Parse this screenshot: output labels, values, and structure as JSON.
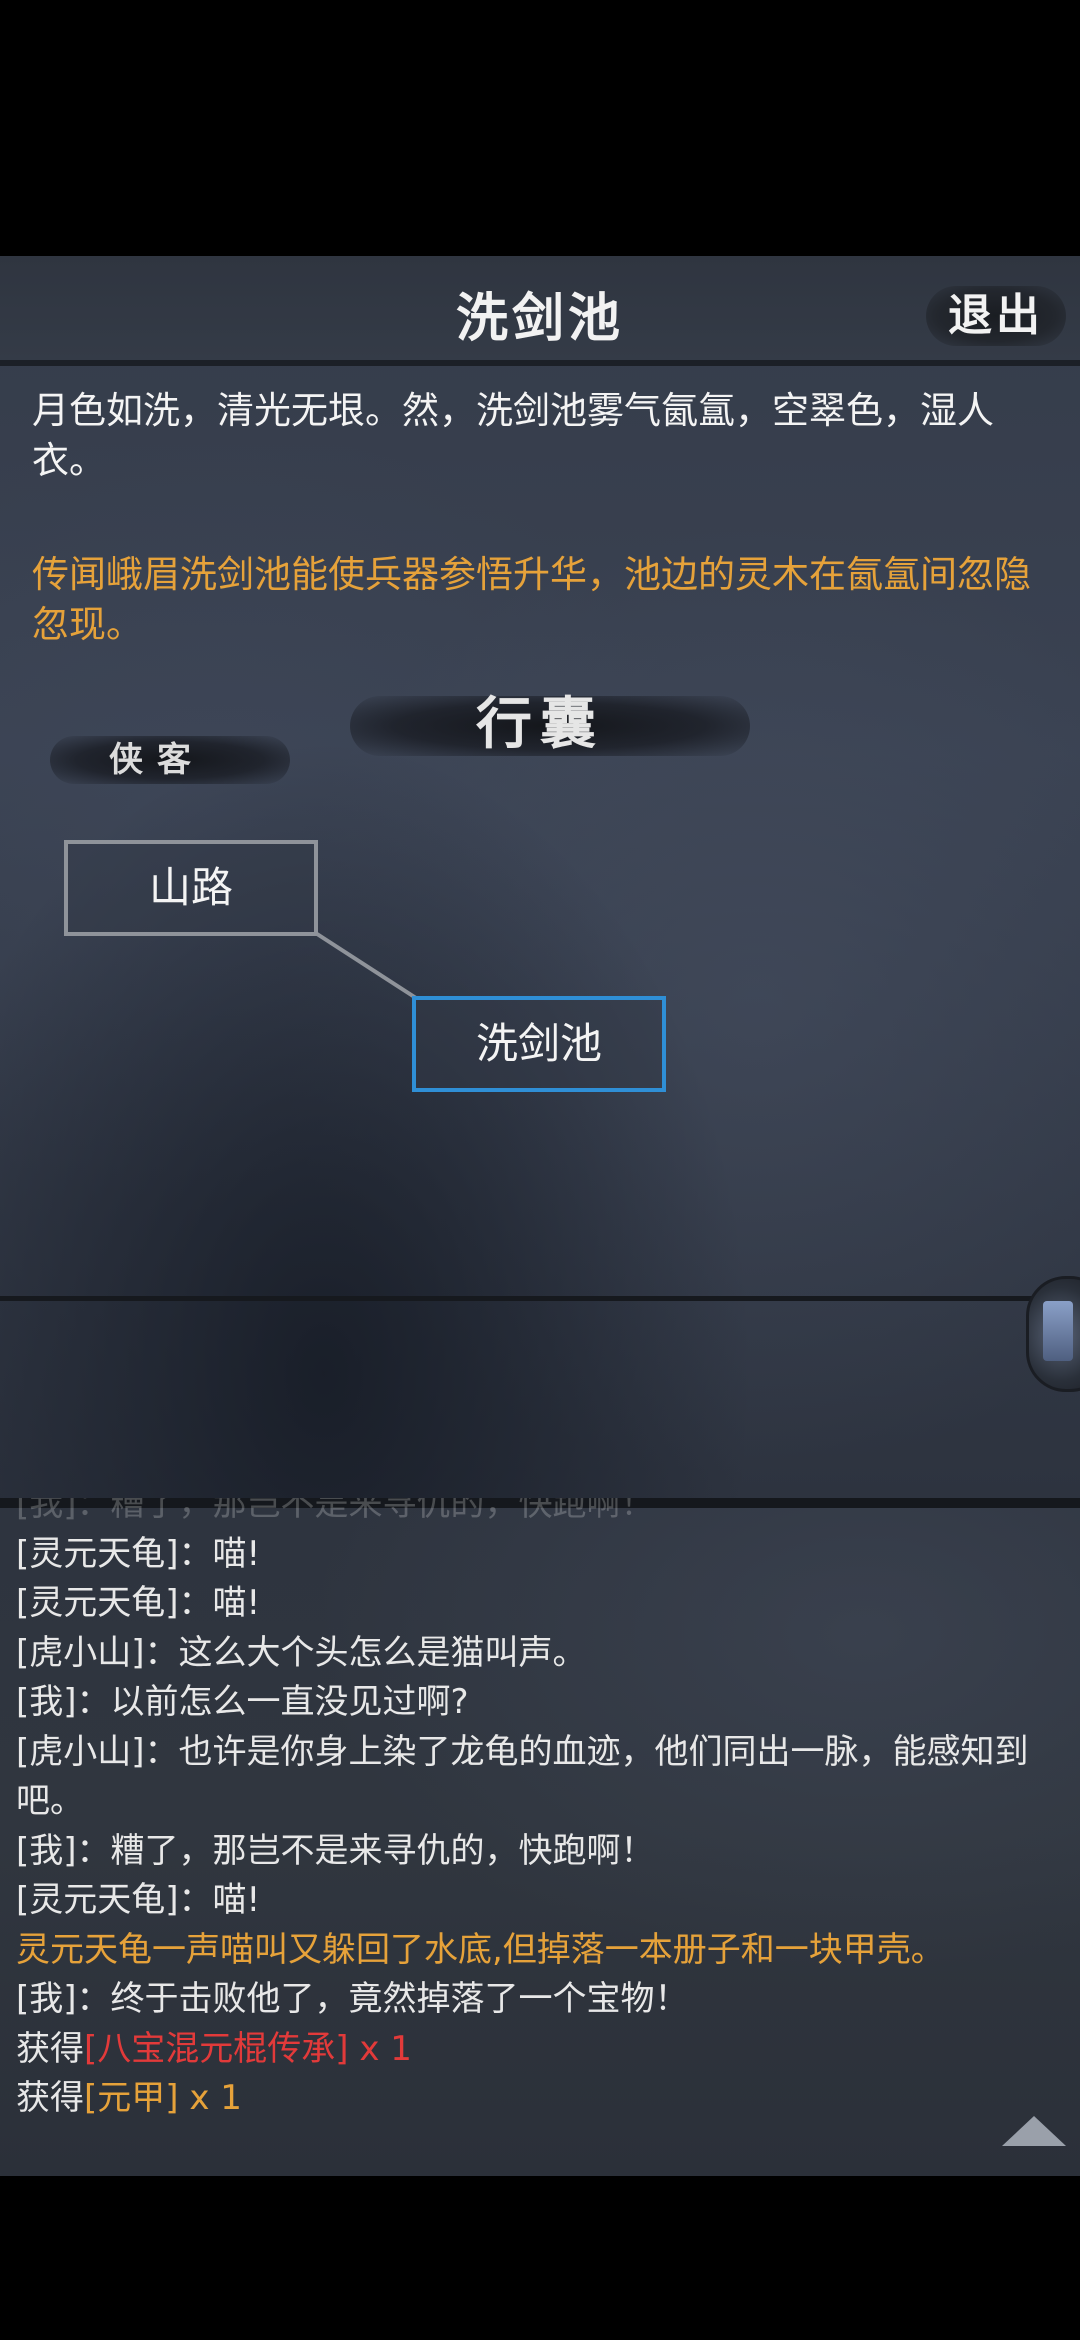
{
  "header": {
    "title": "洗剑池",
    "exit_label": "退出"
  },
  "location": {
    "description": "月色如洗，清光无垠。然，洗剑池雾气氤氲，空翠色，湿人衣。",
    "rumor": "传闻峨眉洗剑池能使兵器参悟升华，池边的灵木在氤氲间忽隐忽现。"
  },
  "menu": {
    "bag_label": "行囊",
    "hero_label": "侠客"
  },
  "map": {
    "nodes": [
      {
        "label": "山路",
        "current": false
      },
      {
        "label": "洗剑池",
        "current": true
      }
    ]
  },
  "log": {
    "faded_line": "[我]：糟了，那岂不是来寻仇的，快跑啊！",
    "lines": [
      {
        "text": "[灵元天龟]：喵!"
      },
      {
        "text": "[灵元天龟]：喵!"
      },
      {
        "text": "[虎小山]：这么大个头怎么是猫叫声。"
      },
      {
        "text": "[我]：以前怎么一直没见过啊?"
      },
      {
        "text": "[虎小山]：也许是你身上染了龙龟的血迹，他们同出一脉，能感知到吧。"
      },
      {
        "text": "[我]：糟了，那岂不是来寻仇的，快跑啊！"
      },
      {
        "text": "[灵元天龟]：喵!"
      }
    ],
    "event_line": "灵元天龟一声喵叫又躲回了水底,但掉落一本册子和一块甲壳。",
    "victory_line": "[我]：终于击败他了，竟然掉落了一个宝物！",
    "loot": [
      {
        "prefix": "获得",
        "item": "[八宝混元棍传承]",
        "suffix": " x 1"
      },
      {
        "prefix": "获得",
        "item": "[元甲]",
        "suffix": " x 1"
      }
    ]
  },
  "colors": {
    "rumor": "#e6a23a",
    "rare_item": "#e23a3a",
    "item": "#e6a23a",
    "current_node_border": "#2f8fd6"
  },
  "icons": {
    "scroll": "triangle-up",
    "side_tab": "scroll-tab"
  }
}
